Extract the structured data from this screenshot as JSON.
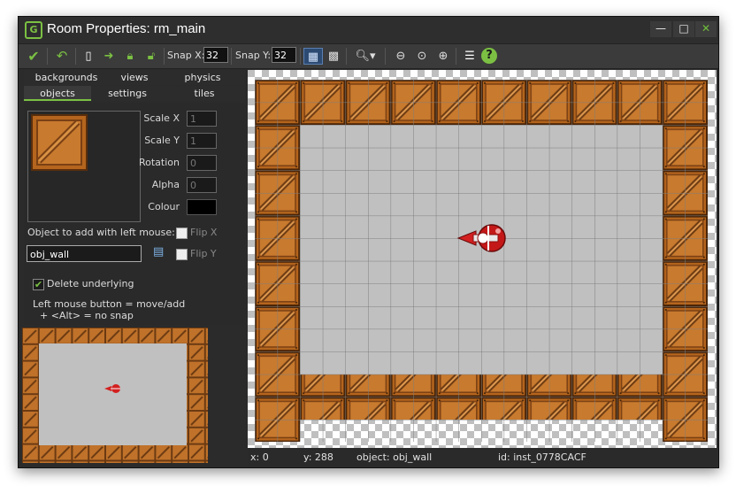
{
  "window": {
    "title": "Room Properties: rm_main",
    "controls": {
      "minimize": "—",
      "maximize": "□",
      "close": "✕"
    }
  },
  "toolbar": {
    "snap_x_label": "Snap X:",
    "snap_x_value": "32",
    "snap_y_label": "Snap Y:",
    "snap_y_value": "32"
  },
  "tabs": {
    "row1": [
      "backgrounds",
      "views",
      "physics"
    ],
    "row2": [
      "objects",
      "settings",
      "tiles"
    ],
    "active": "objects"
  },
  "objects_panel": {
    "scale_x_label": "Scale X",
    "scale_x_value": "1",
    "scale_y_label": "Scale Y",
    "scale_y_value": "1",
    "rotation_label": "Rotation",
    "rotation_value": "0",
    "alpha_label": "Alpha",
    "alpha_value": "0",
    "colour_label": "Colour",
    "colour_value": "#000000",
    "add_object_label": "Object to add with left mouse:",
    "object_name": "obj_wall",
    "flip_x_label": "Flip X",
    "flip_y_label": "Flip Y",
    "delete_underlying_label": "Delete underlying",
    "delete_underlying_checked": true,
    "help_line1": "Left mouse button = move/add",
    "help_line2": "+ <Alt> = no snap"
  },
  "status_bar": {
    "x": "x: 0",
    "y": "y: 288",
    "object": "object: obj_wall",
    "id": "id: inst_0778CACF"
  },
  "colors": {
    "accent_green": "#7bc043",
    "room_bg": "#c0c0c0",
    "grid_line": "#8a8a8a",
    "crate": "#c0722a",
    "crate_dark": "#6b3a12",
    "player_red": "#d32020"
  }
}
